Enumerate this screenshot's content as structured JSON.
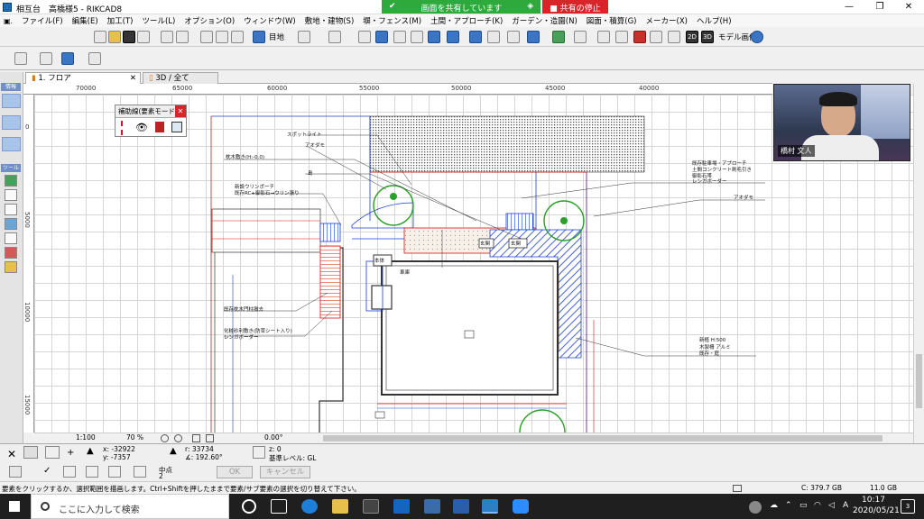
{
  "window": {
    "title": "相互台　高橋様5 - RIKCAD8",
    "controls": [
      "—",
      "❐",
      "✕"
    ]
  },
  "screen_share": {
    "status": "画面を共有しています",
    "stop_label": "共有の停止"
  },
  "menubar": {
    "items": [
      "ファイル(F)",
      "編集(E)",
      "加工(T)",
      "ツール(L)",
      "オプション(O)",
      "ウィンドウ(W)",
      "敷地・建物(S)",
      "塀・フェンス(M)",
      "土間・アプローチ(K)",
      "ガーデン・造園(N)",
      "図面・積算(G)",
      "メーカー(X)",
      "ヘルプ(H)"
    ]
  },
  "toolbar": {
    "layer_label": "目地",
    "model_image_label": "モデル画像",
    "view_2d": "2D",
    "view_3d": "3D"
  },
  "tabs": [
    {
      "label": "1. フロア"
    },
    {
      "label": "3D / 全て"
    }
  ],
  "left_panel": {
    "header1": "情報",
    "header2": "ツール"
  },
  "ruler": {
    "top": [
      "70000",
      "65000",
      "60000",
      "55000",
      "50000",
      "45000",
      "40000"
    ],
    "left": [
      "0",
      "5000",
      "10000",
      "15000"
    ]
  },
  "aux_palette": {
    "title": "補助線(要素モード)"
  },
  "drawing_labels": [
    "スポットライト",
    "アオダモ",
    "枕木敷き(H:-0.0)",
    "島",
    "新設ウリンポーチ",
    "既存RC+御影石→ウリン張り",
    "既存枕木門柱撤去",
    "化粧砂利敷き(防草シート入り)",
    "レンガボーダー",
    "既存駐車場・アプローチ",
    "土間コンクリート刷毛引き",
    "御影石帯",
    "レンガボーダー",
    "アオダモ",
    "新植 H:500",
    "木製柵 アルミ",
    "既存・庭",
    "玄関",
    "玄関",
    "本体",
    "車庫"
  ],
  "video": {
    "participant": "橋村 文人"
  },
  "coordinates": {
    "x": "-32922",
    "y": "-7357",
    "r": "33734",
    "angle": "192.60°",
    "z": "0",
    "base_level": "基準レベル: GL",
    "scale": "1:100",
    "zoom": "70 %",
    "rotation": "0.00°"
  },
  "bottom_buttons": {
    "ok": "OK",
    "cancel": "キャンセル",
    "snap_label": "中点",
    "snap_value": "2"
  },
  "status": {
    "message": "要素をクリックするか、選択範囲を描画します。Ctrl+Shiftを押したままで要素/サブ要素の選択を切り替えて下さい。",
    "disk_c": "C: 379.7 GB",
    "memory": "11.0 GB"
  },
  "taskbar": {
    "search_placeholder": "ここに入力して検索",
    "time": "10:17",
    "date": "2020/05/21",
    "ime": "A",
    "notif_count": "3"
  },
  "colors": {
    "share_green": "#2eaa3c",
    "stop_red": "#d9252a",
    "plan_red": "#d11",
    "plan_blue": "#1a3cd8",
    "hatch_dark": "#555"
  }
}
